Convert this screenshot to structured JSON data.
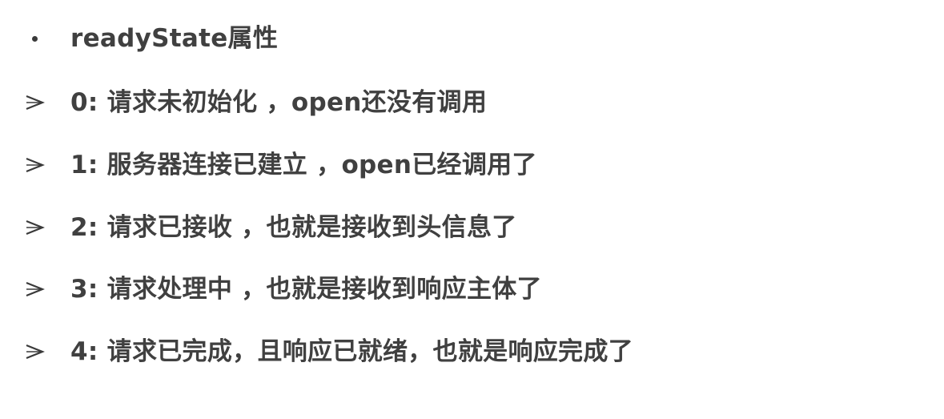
{
  "slide": {
    "heading": "readyState属性",
    "states": [
      "0: 请求未初始化 ，open还没有调用",
      "1: 服务器连接已建立 ，open已经调用了",
      "2: 请求已接收 ，也就是接收到头信息了",
      "3: 请求处理中 ，也就是接收到响应主体了",
      "4: 请求已完成，且响应已就绪，也就是响应完成了"
    ]
  },
  "icons": {
    "heading_bullet": "dot-bullet-icon",
    "state_bullet": "arrow-bullet-icon"
  },
  "colors": {
    "text": "#404040",
    "bullet": "#3a3a3a",
    "background": "#ffffff"
  }
}
